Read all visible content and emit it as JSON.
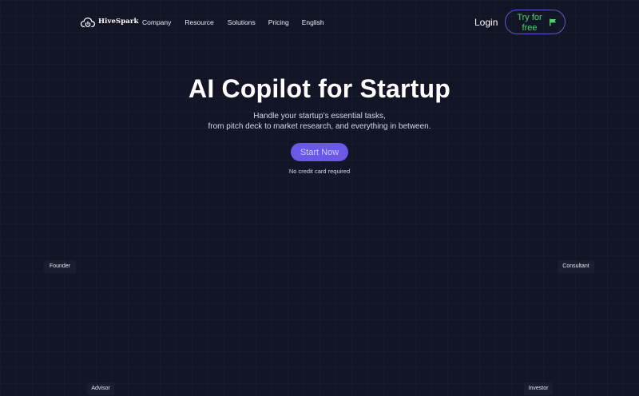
{
  "brand": {
    "name": "HiveSpark",
    "logo_icon": "cloud-power-icon",
    "accent_color": "#6c58e8",
    "cta_text_color": "#4ed471",
    "background_color": "#121526"
  },
  "nav": {
    "links": [
      "Company",
      "Resource",
      "Solutions",
      "Pricing",
      "English"
    ],
    "login_label": "Login",
    "try_button": {
      "label_line1": "Try for",
      "label_line2": "free",
      "icon": "flag-icon"
    }
  },
  "hero": {
    "title": "AI Copilot for Startup",
    "subtitle_line1": "Handle your startup’s essential tasks,",
    "subtitle_line2": "from pitch deck to market research, and everything in between.",
    "cta_label": "Start Now",
    "note": "No credit card required"
  },
  "roles": {
    "founder": "Founder",
    "consultant": "Consultant",
    "advisor": "Advisor",
    "investor": "Investor"
  }
}
